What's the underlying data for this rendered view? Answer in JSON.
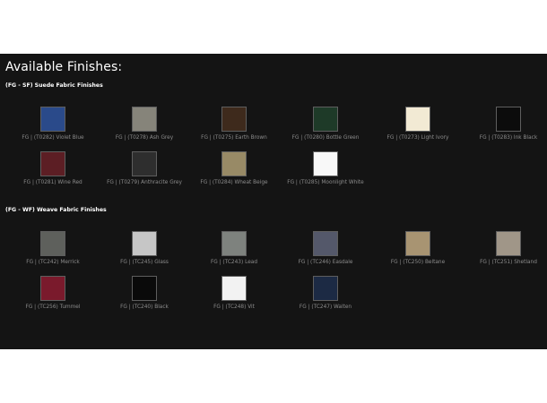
{
  "page": {
    "heading": "Available Finishes:"
  },
  "sections": [
    {
      "title": "(FG - SF) Suede Fabric Finishes",
      "swatches": [
        {
          "label": "FG | (T0282) Violet Blue",
          "color": "#2a4a8a"
        },
        {
          "label": "FG | (T0278) Ash Grey",
          "color": "#86847a"
        },
        {
          "label": "FG | (T0275) Earth Brown",
          "color": "#3e2a1c"
        },
        {
          "label": "FG | (T0280) Bottle Green",
          "color": "#1e3a28"
        },
        {
          "label": "FG | (T0273) Light Ivory",
          "color": "#f2ead4"
        },
        {
          "label": "FG | (T0283) Ink Black",
          "color": "#0c0c0c"
        },
        {
          "label": "FG | (T0281) Wine Red",
          "color": "#5c1e24"
        },
        {
          "label": "FG | (T0279) Anthracite Grey",
          "color": "#2e2e2e"
        },
        {
          "label": "FG | (T0284) Wheat Beige",
          "color": "#988a66"
        },
        {
          "label": "FG | (T0285) Moonlight White",
          "color": "#f8f8f8"
        }
      ]
    },
    {
      "title": "(FG - WF) Weave Fabric Finishes",
      "swatches": [
        {
          "label": "FG | (TC242) Merrick",
          "color": "#5e605c"
        },
        {
          "label": "FG | (TC245) Glass",
          "color": "#c6c6c6"
        },
        {
          "label": "FG | (TC243) Lead",
          "color": "#7e827e"
        },
        {
          "label": "FG | (TC246) Easdale",
          "color": "#54586a"
        },
        {
          "label": "FG | (TC250) Beltane",
          "color": "#a89472"
        },
        {
          "label": "FG | (TC251) Shetland",
          "color": "#a09688"
        },
        {
          "label": "FG | (TC256) Tummel",
          "color": "#7a1a2c"
        },
        {
          "label": "FG | (TC240) Black",
          "color": "#0a0a0a"
        },
        {
          "label": "FG | (TC248) Vit",
          "color": "#f2f2f2"
        },
        {
          "label": "FG | (TC247) Walten",
          "color": "#1c2a44"
        }
      ]
    }
  ]
}
